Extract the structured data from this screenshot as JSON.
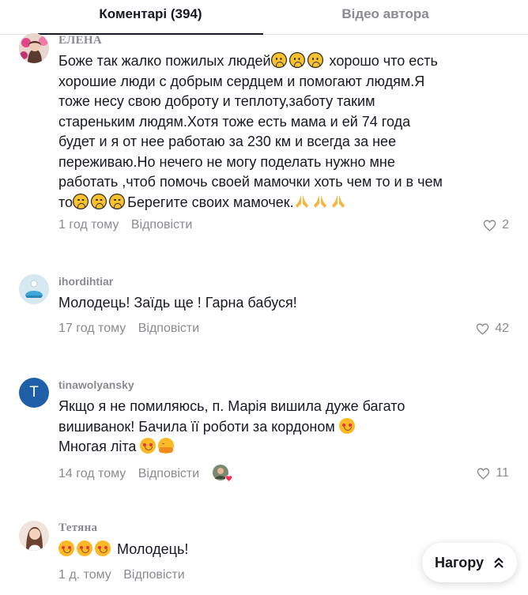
{
  "tabs": {
    "comments": "Коментарі (394)",
    "author_videos": "Відео автора"
  },
  "comments": [
    {
      "username": "ЕЛЕНА",
      "text_lines": [
        "Боже так жалко пожилых людей",
        " хорошо что есть",
        "хорошие люди с добрым сердцем и помогают людям.Я",
        "тоже несу свою доброту и теплоту,заботу таким",
        "стареньким людям.Хотя тоже есть мама и ей 74 года",
        "будет и я от нее работаю за 230 км и всегда за нее",
        "переживаю.Но нечего не могу поделать нужно мне",
        "работать ,чтоб помочь своей мамочки хоть чем то и в чем",
        "то",
        "Берегите своих мамочек."
      ],
      "time": "1 год тому",
      "reply": "Відповісти",
      "likes": "2"
    },
    {
      "username": "ihordihtiar",
      "text": "Молодець! Заїдь ще ! Гарна бабуся!",
      "time": "17 год тому",
      "reply": "Відповісти",
      "likes": "42"
    },
    {
      "username": "tinawolyansky",
      "avatar_letter": "T",
      "text_lines": [
        "Якщо я не помиляюсь, п. Марія вишила дуже багато",
        "вишиванок! Бачила її роботи за кордоном",
        "Многая літа"
      ],
      "time": "14 год тому",
      "reply": "Відповісти",
      "likes": "11"
    },
    {
      "username": "Тетяна",
      "text": "Молодець!",
      "time": "1 д. тому",
      "reply": "Відповісти"
    }
  ],
  "scroll_top_button": "Нагору",
  "colors": {
    "text": "#161823",
    "muted": "#8a8b91",
    "avatar_t": "#1f5fa8",
    "divider": "#e3e3e4"
  }
}
